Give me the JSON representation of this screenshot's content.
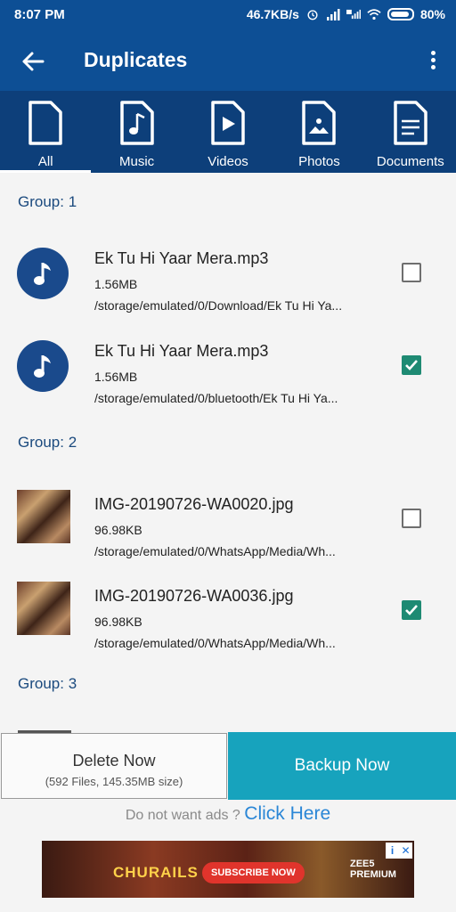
{
  "status": {
    "time": "8:07 PM",
    "speed": "46.7KB/s",
    "battery": "80%"
  },
  "toolbar": {
    "title": "Duplicates"
  },
  "tabs": [
    {
      "label": "All",
      "icon": "file-icon",
      "active": true
    },
    {
      "label": "Music",
      "icon": "music-file-icon",
      "active": false
    },
    {
      "label": "Videos",
      "icon": "video-file-icon",
      "active": false
    },
    {
      "label": "Photos",
      "icon": "photo-file-icon",
      "active": false
    },
    {
      "label": "Documents",
      "icon": "document-file-icon",
      "active": false
    }
  ],
  "groups": [
    {
      "label": "Group: 1",
      "items": [
        {
          "name": "Ek Tu Hi Yaar Mera.mp3",
          "size": "1.56MB",
          "path": "/storage/emulated/0/Download/Ek Tu Hi Ya...",
          "type": "music",
          "checked": false
        },
        {
          "name": "Ek Tu Hi Yaar Mera.mp3",
          "size": "1.56MB",
          "path": "/storage/emulated/0/bluetooth/Ek Tu Hi Ya...",
          "type": "music",
          "checked": true
        }
      ]
    },
    {
      "label": "Group: 2",
      "items": [
        {
          "name": "IMG-20190726-WA0020.jpg",
          "size": "96.98KB",
          "path": "/storage/emulated/0/WhatsApp/Media/Wh...",
          "type": "image",
          "checked": false
        },
        {
          "name": "IMG-20190726-WA0036.jpg",
          "size": "96.98KB",
          "path": "/storage/emulated/0/WhatsApp/Media/Wh...",
          "type": "image",
          "checked": true
        }
      ]
    },
    {
      "label": "Group: 3",
      "items": []
    }
  ],
  "bottom": {
    "delete_label": "Delete Now",
    "delete_sub": "(592 Files, 145.35MB size)",
    "backup_label": "Backup Now"
  },
  "ads_prompt": {
    "question": "Do not want ads ?",
    "link": "Click Here"
  },
  "ad_banner": {
    "title": "CHURAILS",
    "cta": "SUBSCRIBE NOW",
    "brand": "ZEE5 PREMIUM"
  },
  "colors": {
    "toolbar": "#0d4f95",
    "tabs": "#0d3f7a",
    "accent_check": "#1e8a73",
    "backup": "#17a3bd",
    "link": "#2a86d6"
  }
}
